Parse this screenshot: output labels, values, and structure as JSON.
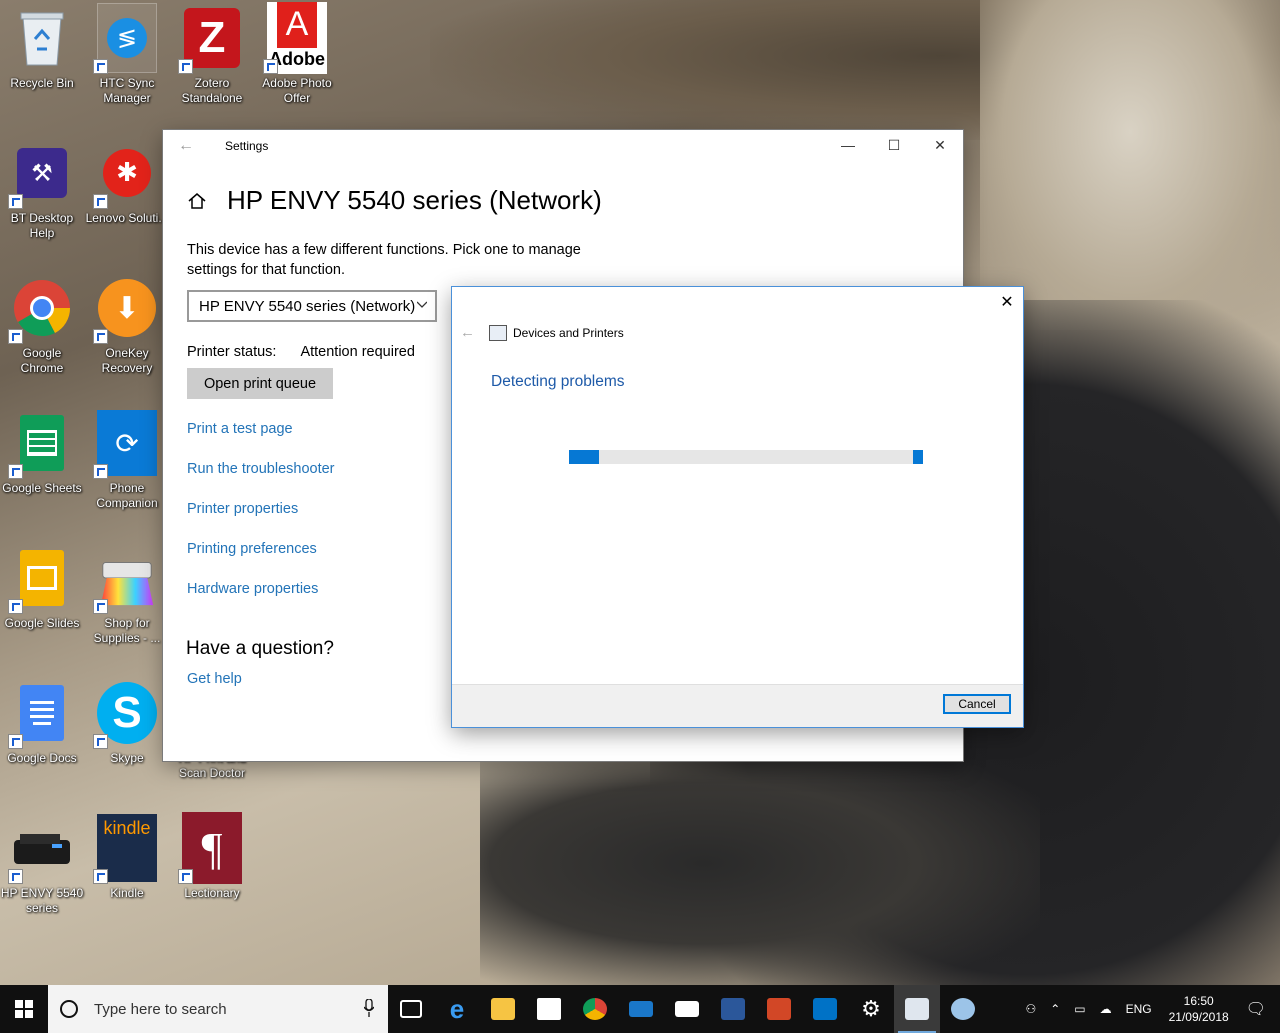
{
  "desktop": {
    "icons": [
      {
        "label": "Recycle Bin"
      },
      {
        "label": "HTC Sync Manager"
      },
      {
        "label": "Zotero Standalone"
      },
      {
        "label": "Adobe Photo Offer"
      },
      {
        "label": "BT Desktop Help"
      },
      {
        "label": "Lenovo Soluti..."
      },
      {
        "label": "Google Chrome"
      },
      {
        "label": "OneKey Recovery"
      },
      {
        "label": "Google Sheets"
      },
      {
        "label": "Phone Companion"
      },
      {
        "label": "Google Slides"
      },
      {
        "label": "Shop for Supplies - ..."
      },
      {
        "label": "Google Docs"
      },
      {
        "label": "Skype"
      },
      {
        "label": "HP Print and Scan Doctor"
      },
      {
        "label": "HP ENVY 5540 series"
      },
      {
        "label": "Kindle"
      },
      {
        "label": "Lectionary"
      }
    ],
    "adobe_logo_text": "Adobe",
    "kindle_logo_text": "kindle"
  },
  "settings": {
    "window_title": "Settings",
    "page_title": "HP ENVY 5540 series (Network)",
    "description": "This device has a few different functions. Pick one to manage settings for that function.",
    "function_select_value": "HP ENVY 5540 series (Network)",
    "printer_status_label": "Printer status:",
    "printer_status_value": "Attention required",
    "open_queue_label": "Open print queue",
    "links": [
      "Print a test page",
      "Run the troubleshooter",
      "Printer properties",
      "Printing preferences",
      "Hardware properties"
    ],
    "question_heading": "Have a question?",
    "get_help_label": "Get help"
  },
  "dialog": {
    "breadcrumb": "Devices and Printers",
    "heading": "Detecting problems",
    "cancel_label": "Cancel"
  },
  "taskbar": {
    "search_placeholder": "Type here to search",
    "language": "ENG",
    "time": "16:50",
    "date": "21/09/2018"
  },
  "colors": {
    "accent": "#0078d7",
    "link": "#2374b8",
    "taskbar": "#101010"
  }
}
